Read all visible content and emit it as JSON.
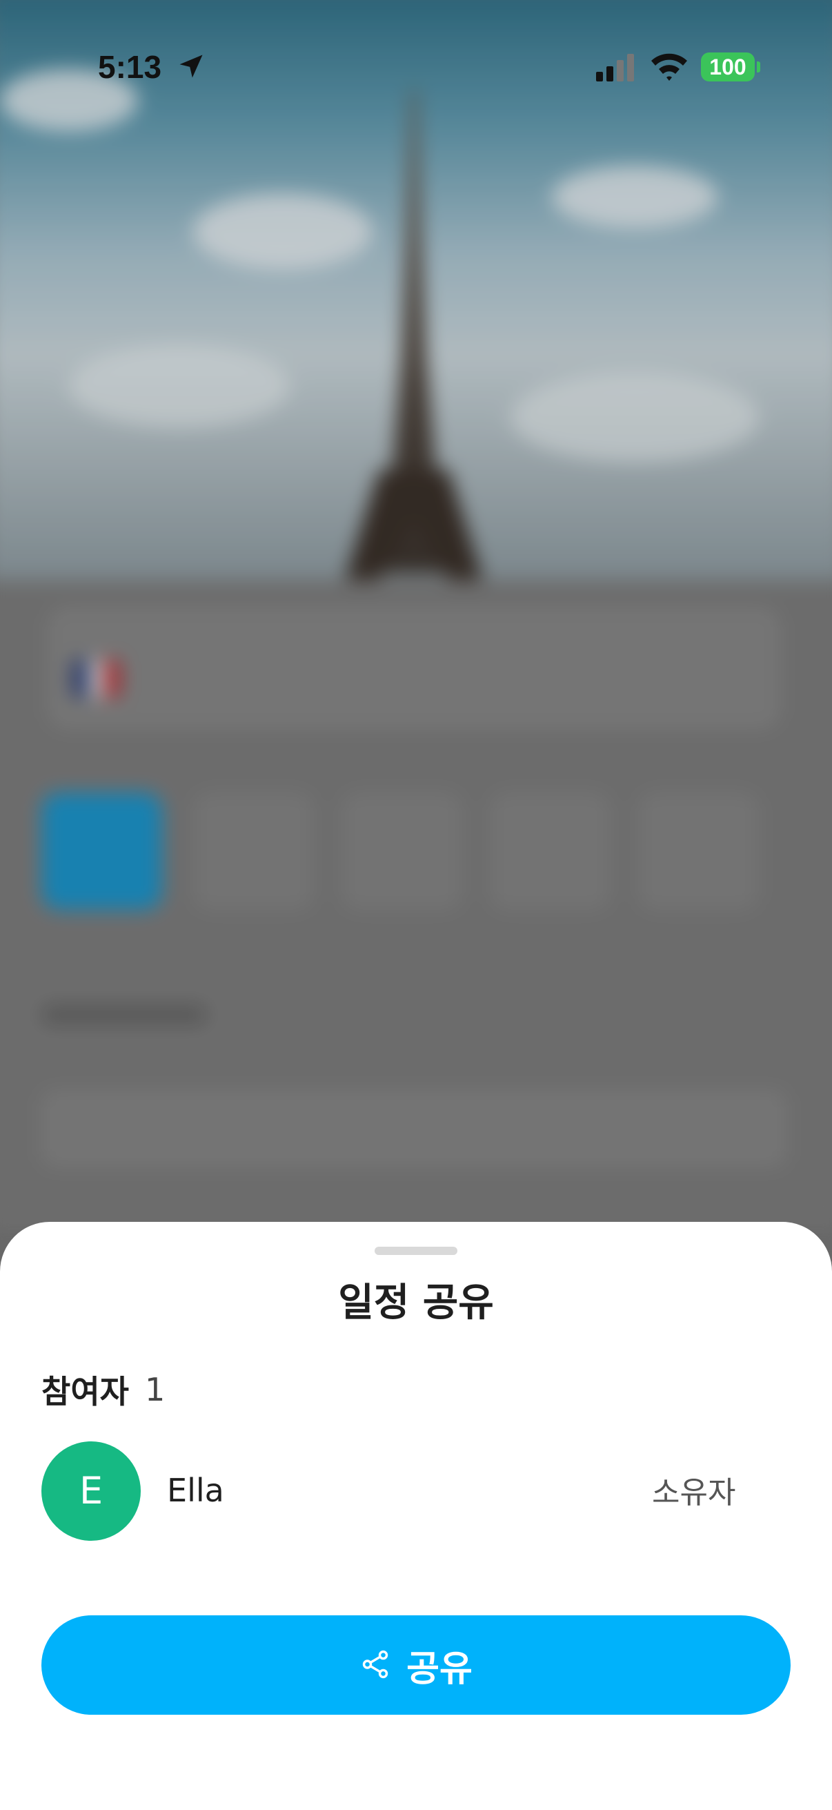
{
  "status_bar": {
    "time": "5:13",
    "battery": "100",
    "battery_color": "#3bc45a"
  },
  "share_sheet": {
    "title": "일정 공유",
    "participants_label": "참여자",
    "participants_count": "1",
    "members": [
      {
        "initial": "E",
        "name": "Ella",
        "role": "소유자",
        "avatar_color": "#16b983"
      }
    ],
    "share_button_label": "공유",
    "share_button_icon": "share-icon",
    "accent_color": "#00b2fb"
  }
}
